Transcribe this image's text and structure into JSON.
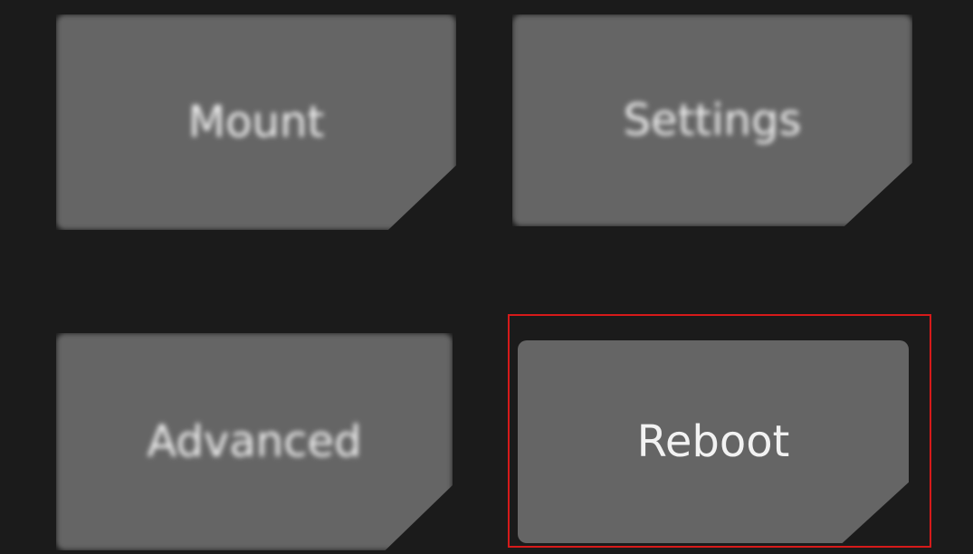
{
  "menu": {
    "items": [
      {
        "label": "Mount"
      },
      {
        "label": "Settings"
      },
      {
        "label": "Advanced"
      },
      {
        "label": "Reboot"
      }
    ]
  },
  "colors": {
    "background": "#1b1b1b",
    "tile": "#656565",
    "label": "#f2f2f2",
    "highlight": "#d61a1a"
  }
}
